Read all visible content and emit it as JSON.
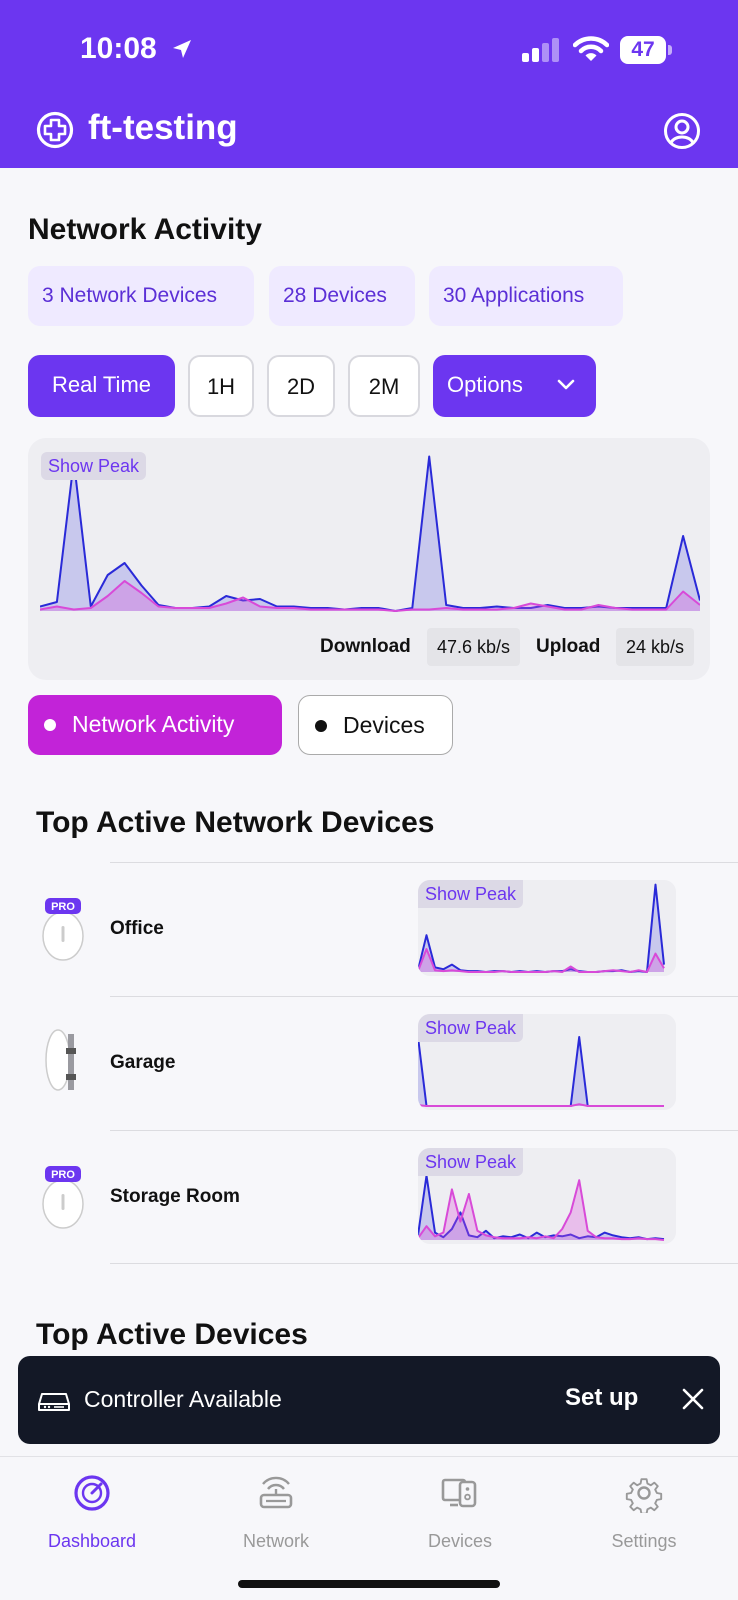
{
  "status_bar": {
    "time": "10:08",
    "battery": "47",
    "battery_level": 0.47
  },
  "header": {
    "title": "ft-testing"
  },
  "network_activity": {
    "title": "Network Activity",
    "chips": [
      "3 Network Devices",
      "28 Devices",
      "30 Applications"
    ],
    "time_buttons": [
      "Real Time",
      "1H",
      "2D",
      "2M"
    ],
    "options_label": "Options",
    "show_peak": "Show Peak",
    "download_label": "Download",
    "download_value": "47.6 kb/s",
    "upload_label": "Upload",
    "upload_value": "24 kb/s",
    "toggle_on": "Network Activity",
    "toggle_off": "Devices"
  },
  "colors": {
    "accent": "#6c36f0",
    "download": "#2a2ad8",
    "upload": "#d84ad8",
    "toggle_on": "#c223d8"
  },
  "chart_data": {
    "type": "area",
    "title": "",
    "xlabel": "",
    "ylabel": "",
    "x": [
      1,
      2,
      3,
      4,
      5,
      6,
      7,
      8,
      9,
      10,
      11,
      12,
      13,
      14,
      15,
      16,
      17,
      18,
      19,
      20,
      21,
      22,
      23,
      24,
      25,
      26,
      27,
      28,
      29,
      30,
      31,
      32,
      33,
      34,
      35,
      36,
      37,
      38,
      39,
      40
    ],
    "series": [
      {
        "name": "Download",
        "values": [
          3,
          6,
          100,
          3,
          24,
          32,
          17,
          4,
          2,
          2,
          3,
          10,
          7,
          8,
          3,
          3,
          2,
          2,
          1,
          2,
          2,
          0,
          2,
          103,
          4,
          2,
          2,
          3,
          2,
          2,
          4,
          2,
          2,
          3,
          2,
          2,
          2,
          2,
          50,
          7
        ]
      },
      {
        "name": "Upload",
        "values": [
          1,
          3,
          1,
          2,
          10,
          20,
          12,
          3,
          2,
          2,
          2,
          5,
          9,
          3,
          2,
          2,
          1,
          1,
          1,
          1,
          1,
          0,
          1,
          1,
          2,
          1,
          1,
          1,
          2,
          5,
          3,
          1,
          1,
          4,
          2,
          1,
          1,
          1,
          13,
          4
        ]
      }
    ],
    "ylim": [
      0,
      110
    ],
    "grid": false,
    "legend": "bottom-right"
  },
  "top_network_devices": {
    "title": "Top Active Network Devices",
    "items": [
      {
        "name": "Office",
        "badge": "PRO",
        "show_peak": "Show Peak",
        "download": [
          2,
          40,
          5,
          3,
          8,
          2,
          1,
          1,
          0,
          1,
          1,
          0,
          1,
          0,
          1,
          0,
          1,
          1,
          3,
          1,
          0,
          0,
          1,
          1,
          2,
          0,
          1,
          0,
          95,
          8
        ],
        "upload": [
          1,
          25,
          2,
          1,
          2,
          1,
          0,
          0,
          0,
          0,
          1,
          0,
          0,
          0,
          0,
          0,
          1,
          0,
          6,
          0,
          0,
          0,
          1,
          2,
          1,
          0,
          2,
          0,
          20,
          4
        ]
      },
      {
        "name": "Garage",
        "badge": "",
        "show_peak": "Show Peak",
        "download": [
          75,
          0,
          0,
          0,
          0,
          0,
          0,
          0,
          0,
          0,
          0,
          0,
          0,
          0,
          0,
          0,
          0,
          0,
          0,
          75,
          0,
          0,
          0,
          0,
          0,
          0,
          0,
          0,
          0,
          0
        ],
        "upload": [
          1,
          0,
          0,
          0,
          0,
          0,
          0,
          0,
          0,
          0,
          0,
          0,
          0,
          0,
          0,
          0,
          0,
          0,
          0,
          2,
          0,
          0,
          0,
          0,
          0,
          0,
          0,
          0,
          0,
          0
        ]
      },
      {
        "name": "Storage Room",
        "badge": "PRO",
        "show_peak": "Show Peak",
        "download": [
          5,
          70,
          8,
          3,
          12,
          30,
          5,
          3,
          10,
          2,
          4,
          3,
          6,
          2,
          8,
          3,
          5,
          4,
          6,
          2,
          4,
          3,
          8,
          5,
          3,
          2,
          3,
          1,
          2,
          1
        ],
        "upload": [
          2,
          15,
          4,
          8,
          55,
          20,
          50,
          10,
          5,
          3,
          2,
          2,
          2,
          3,
          2,
          4,
          2,
          12,
          30,
          65,
          10,
          3,
          2,
          2,
          1,
          1,
          2,
          1,
          1,
          0
        ]
      }
    ]
  },
  "top_devices": {
    "title": "Top Active Devices"
  },
  "toast": {
    "text": "Controller Available",
    "action": "Set up"
  },
  "tabs": [
    "Dashboard",
    "Network",
    "Devices",
    "Settings"
  ]
}
